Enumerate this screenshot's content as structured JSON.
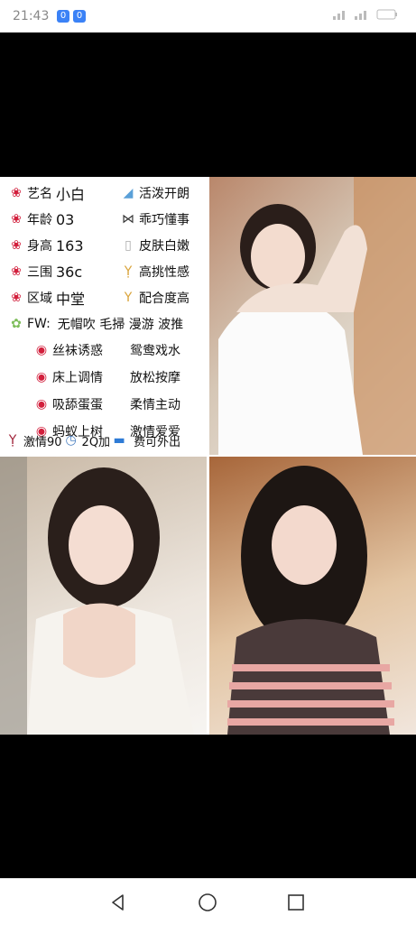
{
  "status_bar": {
    "time": "21:43",
    "badges": [
      "0",
      "0"
    ]
  },
  "profile": {
    "rows": [
      [
        {
          "icon": "tulip-icon",
          "label": "艺名",
          "value": "小白"
        },
        {
          "icon": "sock-icon",
          "label": "活泼开朗"
        }
      ],
      [
        {
          "icon": "tulip-icon",
          "label": "年龄",
          "value": "03"
        },
        {
          "icon": "bow-icon",
          "label": "乖巧懂事"
        }
      ],
      [
        {
          "icon": "tulip-icon",
          "label": "身高",
          "value": "163"
        },
        {
          "icon": "milk-icon",
          "label": "皮肤白嫩"
        }
      ],
      [
        {
          "icon": "tulip-icon",
          "label": "三围",
          "value": "36c"
        },
        {
          "icon": "champagne-icon",
          "label": "高挑性感"
        }
      ],
      [
        {
          "icon": "tulip-icon",
          "label": "区域",
          "value": "中堂"
        },
        {
          "icon": "cocktail-icon",
          "label": "配合度高"
        }
      ],
      [
        {
          "icon": "fairy-icon",
          "label": "FW:",
          "value": "无帽吹  毛掃 漫游 波推"
        }
      ],
      [
        {
          "icon": "lips-icon",
          "label": "丝袜诱惑"
        },
        {
          "label": "鸳鸯戏水"
        }
      ],
      [
        {
          "icon": "lips-icon",
          "label": "床上调情"
        },
        {
          "label": "放松按摩"
        }
      ],
      [
        {
          "icon": "lips-icon",
          "label": "吸舔蛋蛋"
        },
        {
          "label": "柔情主动"
        }
      ],
      [
        {
          "icon": "lips-icon",
          "label": "蚂蚁上树"
        },
        {
          "label": "激情爱爱"
        }
      ]
    ],
    "footer": {
      "part1": "激情90",
      "part2": "2Q加",
      "part3": "费可外出"
    }
  }
}
